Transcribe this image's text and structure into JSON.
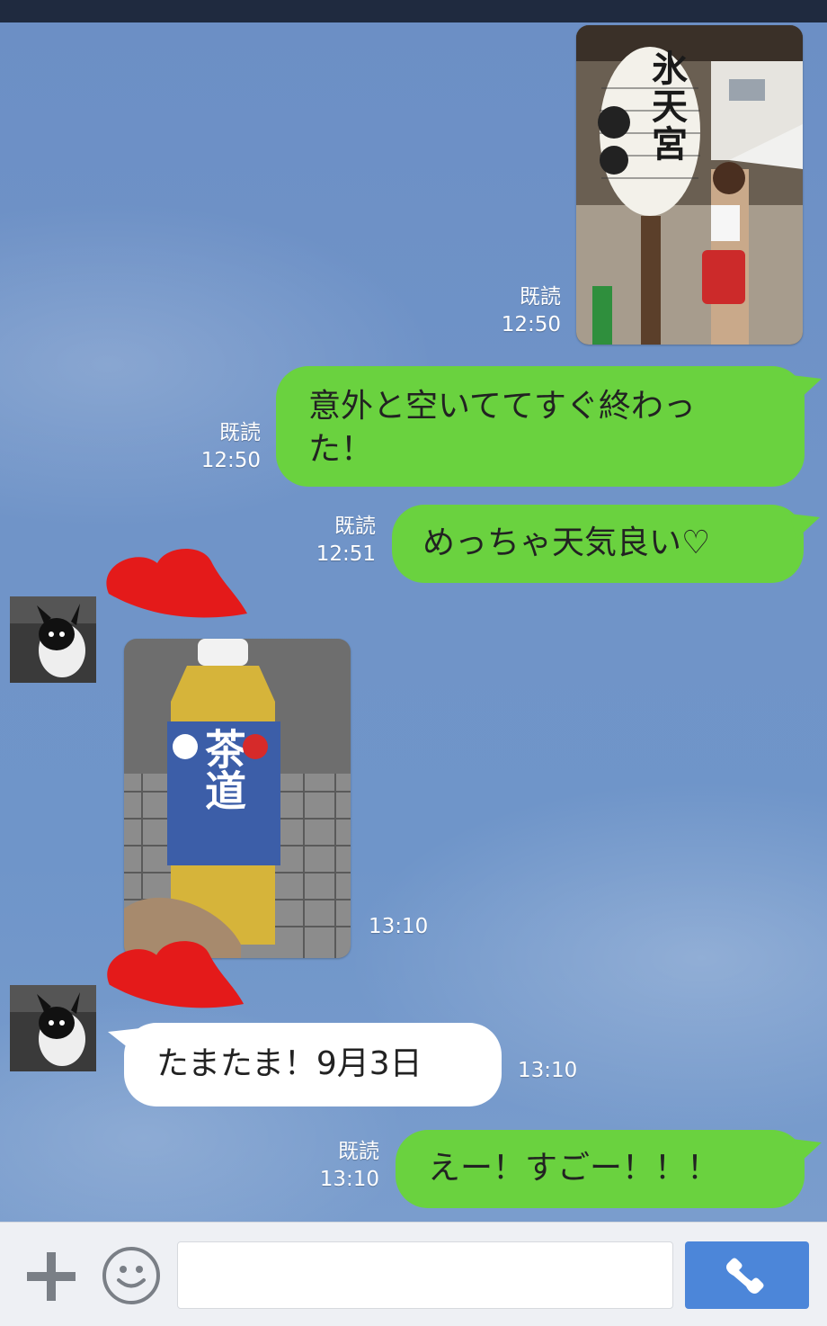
{
  "colors": {
    "chat_bg": "#6f92c6",
    "bubble_sent": "#6ad23f",
    "bubble_received": "#ffffff",
    "send_button": "#4c86d9",
    "heart": "#e41a1a"
  },
  "messages": [
    {
      "type": "image",
      "direction": "sent",
      "read": "既読",
      "time": "12:50",
      "image_text": "氷天宮"
    },
    {
      "type": "text",
      "direction": "sent",
      "read": "既読",
      "time": "12:50",
      "lines": [
        "意外と空いててすぐ終わっ",
        "た！"
      ]
    },
    {
      "type": "text",
      "direction": "sent",
      "read": "既読",
      "time": "12:51",
      "text": "めっちゃ天気良い♡"
    },
    {
      "type": "image",
      "direction": "received",
      "time": "13:10",
      "image_text": "茶道"
    },
    {
      "type": "text",
      "direction": "received",
      "time": "13:10",
      "text": "たまたま！9月3日"
    },
    {
      "type": "text",
      "direction": "sent",
      "read": "既読",
      "time": "13:10",
      "text": "えー！すごー！！！"
    }
  ],
  "input_bar": {
    "plus_icon": "plus-icon",
    "emoji_icon": "smiley-icon",
    "placeholder": "",
    "send_icon": "phone-icon"
  }
}
